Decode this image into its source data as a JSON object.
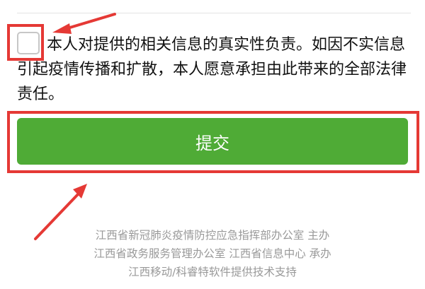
{
  "form": {
    "declaration": "本人对提供的相关信息的真实性负责。如因不实信息引起疫情传播和扩散，本人愿意承担由此带来的全部法律责任。",
    "checkbox_checked": false,
    "submit_label": "提交",
    "submit_color": "#4fab36"
  },
  "annotations": {
    "highlight_color": "#e53935",
    "arrows": [
      "arrow-to-checkbox",
      "arrow-to-submit"
    ]
  },
  "footer": {
    "line1": "江西省新冠肺炎疫情防控应急指挥部办公室 主办",
    "line2": "江西省政务服务管理办公室 江西省信息中心 承办",
    "line3": "江西移动/科睿特软件提供技术支持"
  }
}
